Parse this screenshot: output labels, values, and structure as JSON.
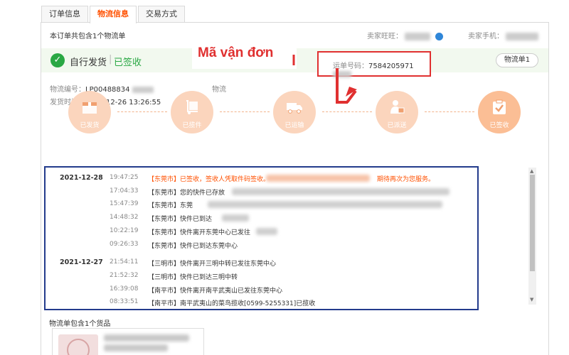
{
  "tabs": [
    {
      "label": "订单信息"
    },
    {
      "label": "物流信息"
    },
    {
      "label": "交易方式"
    }
  ],
  "summary": "本订单共包含1个物流单",
  "seller": {
    "wangwang_label": "卖家旺旺：",
    "phone_label": "卖家手机："
  },
  "status": {
    "shipping_mode": "自行发货",
    "separator": "|",
    "state": "已签收",
    "logistics_button": "物流单1"
  },
  "meta": {
    "logistics_no_label": "物流编号：",
    "logistics_no_value": "LP00488834",
    "ship_time_label": "发货时间：",
    "ship_time_value": "2021-12-26 13:26:55",
    "company_label": "物流",
    "waybill_label": "运单号码：",
    "waybill_value": "7584205971"
  },
  "annotation": {
    "text": "Mã vận đơn",
    "color": "#e03030"
  },
  "steps": [
    {
      "label": "已发货",
      "icon": "box-icon"
    },
    {
      "label": "已揽件",
      "icon": "dolly-icon"
    },
    {
      "label": "已运输",
      "icon": "truck-icon"
    },
    {
      "label": "已派送",
      "icon": "courier-icon"
    },
    {
      "label": "已签收",
      "icon": "signed-icon"
    }
  ],
  "tracking": [
    {
      "date": "2021-12-28",
      "time": "19:47:25",
      "desc": "【东莞市】已签收，签收人凭取件码签收。",
      "tail": "期待再次为您服务。",
      "highlight": true
    },
    {
      "date": "",
      "time": "17:04:33",
      "desc": "【东莞市】您的快件已存放",
      "tail": "",
      "highlight": false
    },
    {
      "date": "",
      "time": "15:47:39",
      "desc": "【东莞市】东莞",
      "tail": "",
      "highlight": false
    },
    {
      "date": "",
      "time": "14:48:32",
      "desc": "【东莞市】快件已到达",
      "tail": "",
      "highlight": false
    },
    {
      "date": "",
      "time": "10:22:19",
      "desc": "【东莞市】快件离开东莞中心已发往",
      "tail": "",
      "highlight": false
    },
    {
      "date": "",
      "time": "09:26:33",
      "desc": "【东莞市】快件已到达东莞中心",
      "tail": "",
      "highlight": false
    },
    {
      "date": "2021-12-27",
      "time": "21:54:11",
      "desc": "【三明市】快件离开三明中转已发往东莞中心",
      "tail": "",
      "highlight": false
    },
    {
      "date": "",
      "time": "21:52:32",
      "desc": "【三明市】快件已到达三明中转",
      "tail": "",
      "highlight": false
    },
    {
      "date": "",
      "time": "16:39:08",
      "desc": "【南平市】快件离开南平武夷山已发往东莞中心",
      "tail": "",
      "highlight": false
    },
    {
      "date": "",
      "time": "08:33:51",
      "desc": "【南平市】南平武夷山的菜鸟揽收[0599-5255331]已揽收",
      "tail": "",
      "highlight": false
    }
  ],
  "goods": {
    "title": "物流单包含1个货品"
  },
  "colors": {
    "accent": "#ff5000",
    "success": "#2aa844",
    "step_circle": "#fbd5bd",
    "annotation_frame": "#233b8c"
  }
}
